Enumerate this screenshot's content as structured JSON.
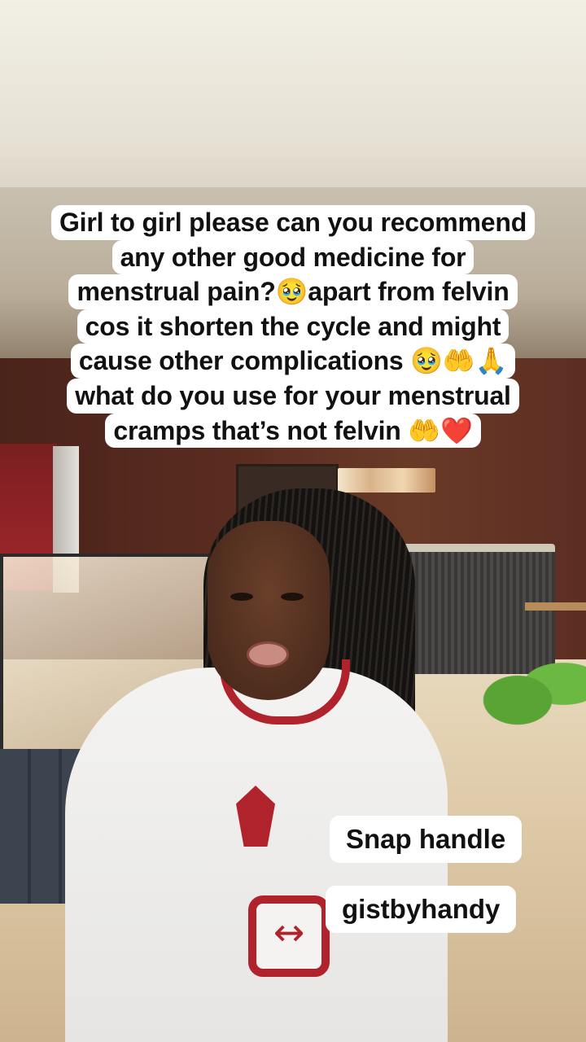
{
  "caption": {
    "lines": [
      "Girl to girl please can you recommend",
      "any other good medicine for",
      "menstrual pain?🥹apart from felvin",
      "cos it shorten the cycle and might",
      "cause other complications 🥹🤲🙏",
      "what do you use for your menstrual",
      "cramps that’s not felvin 🤲❤️"
    ]
  },
  "overlay": {
    "snap_label": "Snap handle",
    "handle": "gistbyhandy"
  }
}
